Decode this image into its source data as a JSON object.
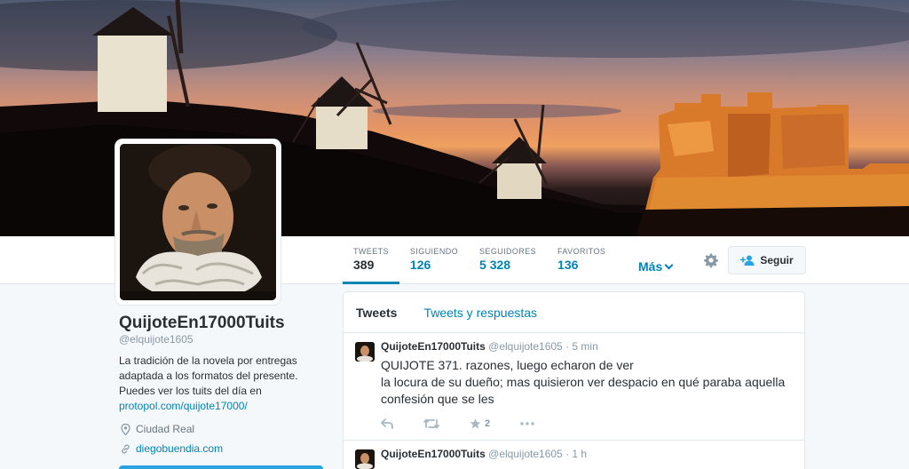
{
  "colors": {
    "link": "#0084b4",
    "text": "#292f33",
    "muted": "#8899a6",
    "border": "#e1e8ed"
  },
  "nav": {
    "stats": [
      {
        "label": "TWEETS",
        "value": "389",
        "active": true
      },
      {
        "label": "SIGUIENDO",
        "value": "126"
      },
      {
        "label": "SEGUIDORES",
        "value": "5 328"
      },
      {
        "label": "FAVORITOS",
        "value": "136"
      }
    ],
    "more_label": "Más",
    "follow_label": "Seguir"
  },
  "profile": {
    "name": "QuijoteEn17000Tuits",
    "handle": "@elquijote1605",
    "bio_text": "La tradición de la novela por entregas adaptada a los formatos del presente. Puedes ver los tuits del día en",
    "bio_link": "protopol.com/quijote17000/",
    "location": "Ciudad Real",
    "website": "diegobuendia.com"
  },
  "timeline": {
    "tabs": [
      {
        "label": "Tweets",
        "active": true
      },
      {
        "label": "Tweets y respuestas"
      }
    ],
    "tweets": [
      {
        "author": "QuijoteEn17000Tuits",
        "handle": "@elquijote1605",
        "time": "5 min",
        "text": "QUIJOTE 371. razones, luego echaron de ver\nla locura de su dueño; mas quisieron ver despacio en qué paraba aquella confesión que se les",
        "favorites": "2"
      },
      {
        "author": "QuijoteEn17000Tuits",
        "handle": "@elquijote1605",
        "time": "1 h",
        "text": ""
      }
    ]
  }
}
